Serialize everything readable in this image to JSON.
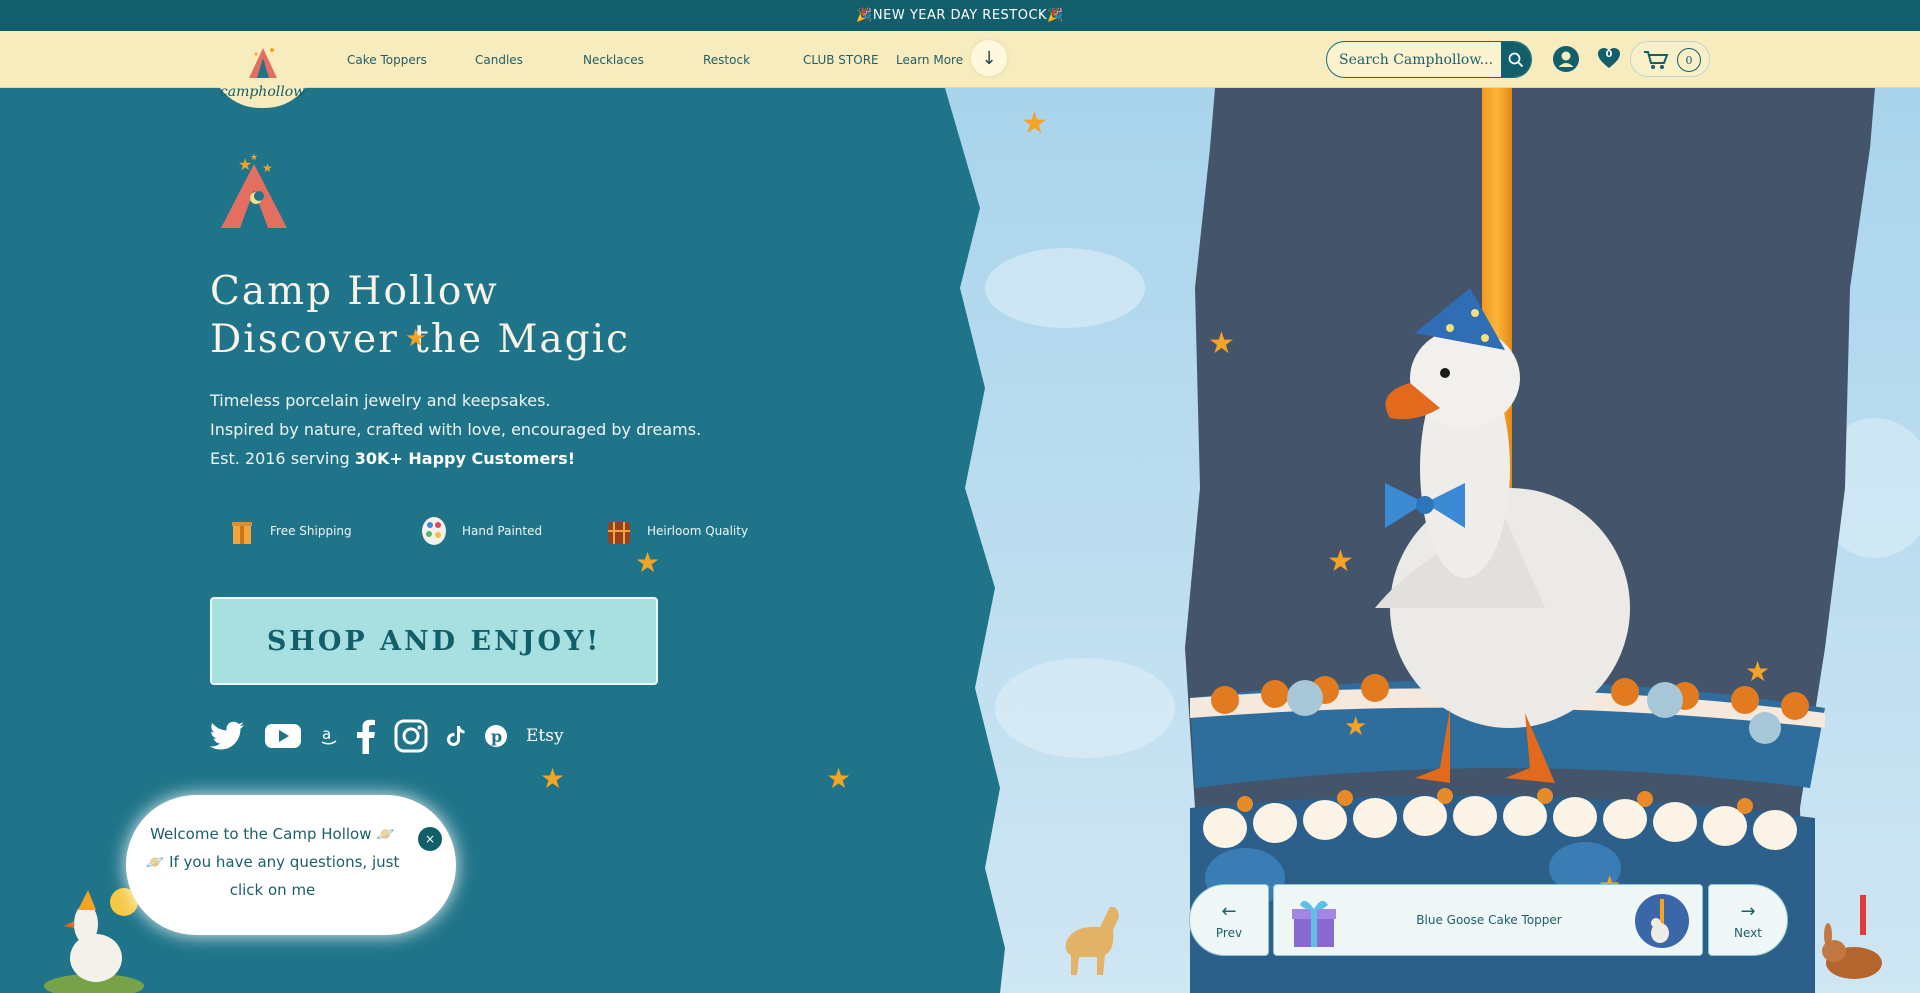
{
  "announcement": "🎉NEW YEAR DAY RESTOCK🎉",
  "header": {
    "brand": "camphollow",
    "nav": [
      "Cake Toppers",
      "Candles",
      "Necklaces",
      "Restock",
      "CLUB STORE",
      "Learn More"
    ],
    "search_placeholder": "Search Camphollow...",
    "wishlist_count": "0",
    "cart_count": "0"
  },
  "hero": {
    "title_line1": "Camp Hollow",
    "title_line2": "Discover the Magic",
    "tagline1": "Timeless porcelain jewelry and keepsakes.",
    "tagline2": "Inspired by nature, crafted with love, encouraged by dreams.",
    "tagline3_prefix": "Est. 2016 serving ",
    "tagline3_bold": "30K+ Happy Customers!",
    "features": [
      "Free Shipping",
      "Hand Painted",
      "Heirloom Quality"
    ],
    "cta": "SHOP AND ENJOY!",
    "etsy": "Etsy"
  },
  "chat": {
    "line1": "Welcome to the Camp Hollow 🪐",
    "line2": "🪐 If you have any questions, just click on me",
    "close": "×"
  },
  "slider": {
    "prev": "Prev",
    "next": "Next",
    "title": "Blue Goose Cake Topper"
  },
  "colors": {
    "announce_bg": "#135e6b",
    "header_bg": "#f7ecbe",
    "hero_bg": "#1f7489",
    "cta_bg": "#a8e0e1",
    "star": "#f5a325"
  }
}
